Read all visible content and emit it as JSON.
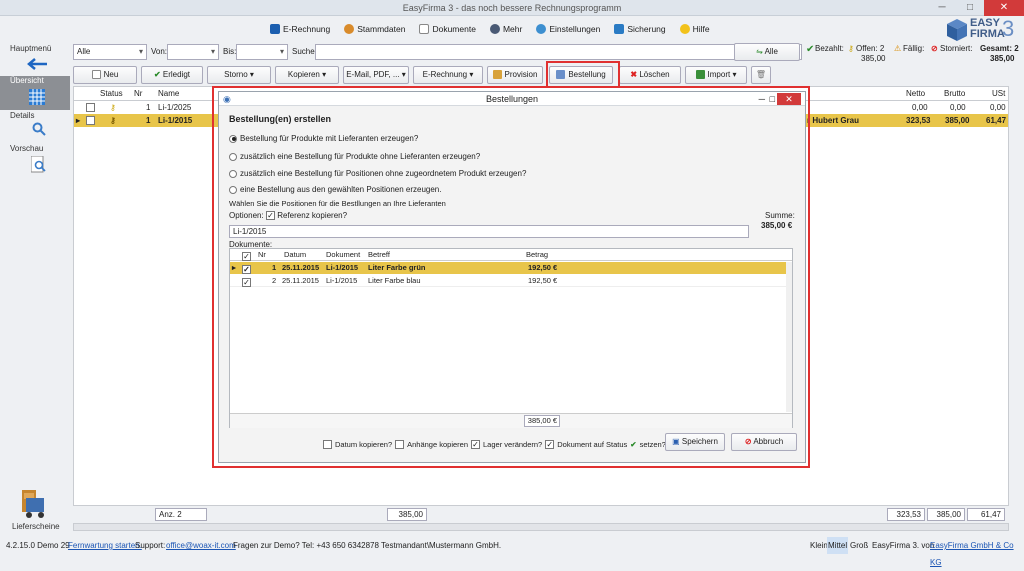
{
  "window": {
    "title": "EasyFirma 3 - das noch bessere Rechnungsprogramm",
    "min": "─",
    "max": "□",
    "close": "✕"
  },
  "menu": [
    {
      "label": "E-Rechnung",
      "icon": "e-icon"
    },
    {
      "label": "Stammdaten",
      "icon": "people-icon"
    },
    {
      "label": "Dokumente",
      "icon": "document-icon"
    },
    {
      "label": "Mehr",
      "icon": "more-icon"
    },
    {
      "label": "Einstellungen",
      "icon": "gear-icon"
    },
    {
      "label": "Sicherung",
      "icon": "save-icon"
    },
    {
      "label": "Hilfe",
      "icon": "help-icon"
    }
  ],
  "logo": {
    "line1": "EASY",
    "line2": "FIRMA",
    "version": "3"
  },
  "sidebar": {
    "hauptmenu": "Hauptmenü",
    "uebersicht": "Übersicht",
    "details": "Details",
    "vorschau": "Vorschau",
    "lieferscheine": "Lieferscheine"
  },
  "filter": {
    "all": "Alle",
    "von": "Von:",
    "bis": "Bis:",
    "suche": "Suche:",
    "alle_btn": "Alle"
  },
  "summary": {
    "bezahlt": "Bezahlt:",
    "offen": "Offen: 2",
    "offen_val": "385,00",
    "faellig": "Fällig:",
    "storniert": "Storniert:",
    "gesamt": "Gesamt: 2",
    "gesamt_val": "385,00"
  },
  "toolbar": {
    "neu": "Neu",
    "erledigt": "Erledigt",
    "storno": "Storno",
    "kopieren": "Kopieren",
    "email": "E-Mail, PDF, ...",
    "erechnung": "E-Rechnung",
    "provision": "Provision",
    "bestellung": "Bestellung",
    "loeschen": "Löschen",
    "import": "Import"
  },
  "grid": {
    "headers": {
      "status": "Status",
      "nr": "Nr",
      "name": "Name",
      "netto": "Netto",
      "brutto": "Brutto",
      "ust": "USt"
    },
    "rows": [
      {
        "nr": "1",
        "name": "Li-1/2025",
        "netto": "0,00",
        "brutto": "0,00",
        "ust": "0,00"
      },
      {
        "nr": "1",
        "name": "Li-1/2015",
        "customer": "r Hubert Grau",
        "netto": "323,53",
        "brutto": "385,00",
        "ust": "61,47"
      }
    ],
    "footer": {
      "anz": "Anz. 2",
      "sum": "385,00",
      "netto": "323,53",
      "brutto": "385,00",
      "ust": "61,47"
    }
  },
  "dialog": {
    "title": "Bestellungen",
    "heading": "Bestellung(en) erstellen",
    "options": [
      "Bestellung für Produkte mit Lieferanten erzeugen?",
      "zusätzlich eine Bestellung für Produkte ohne Lieferanten erzeugen?",
      "zusätzlich eine Bestellung für Positionen ohne zugeordnetem Produkt erzeugen?",
      "eine Bestellung aus den gewählten Positionen erzeugen."
    ],
    "hint": "Wählen Sie die Positionen für die Bestllungen an Ihre Lieferanten",
    "optionen": "Optionen:",
    "referenz": "Referenz kopieren?",
    "referenz_val": "Li-1/2015",
    "summe_label": "Summe:",
    "summe_val": "385,00 €",
    "dokumente": "Dokumente:",
    "cols": {
      "nr": "Nr",
      "datum": "Datum",
      "dokument": "Dokument",
      "betreff": "Betreff",
      "betrag": "Betrag"
    },
    "rows": [
      {
        "nr": "1",
        "datum": "25.11.2015",
        "dokument": "Li-1/2015",
        "betreff": "Liter Farbe grün",
        "betrag": "192,50 €"
      },
      {
        "nr": "2",
        "datum": "25.11.2015",
        "dokument": "Li-1/2015",
        "betreff": "Liter Farbe blau",
        "betrag": "192,50 €"
      }
    ],
    "total": "385,00 €",
    "datum_kopieren": "Datum kopieren?",
    "anhaenge": "Anhänge kopieren",
    "lager": "Lager verändern?",
    "status": "Dokument auf Status",
    "setzen": "setzen?",
    "speichern": "Speichern",
    "abbruch": "Abbruch"
  },
  "statusbar": {
    "version": "4.2.15.0 Demo 29",
    "fernwartung": "Fernwartung starten.",
    "support": "Support:",
    "email": "office@woax-it.com",
    "fragen": "Fragen zur Demo? Tel: +43 650 6342878 Testmandant\\Mustermann GmbH.",
    "klein": "Klein",
    "mittel": "Mittel",
    "gross": "Groß",
    "easy": "EasyFirma 3. von",
    "company": "EasyFirma GmbH & Co KG"
  }
}
